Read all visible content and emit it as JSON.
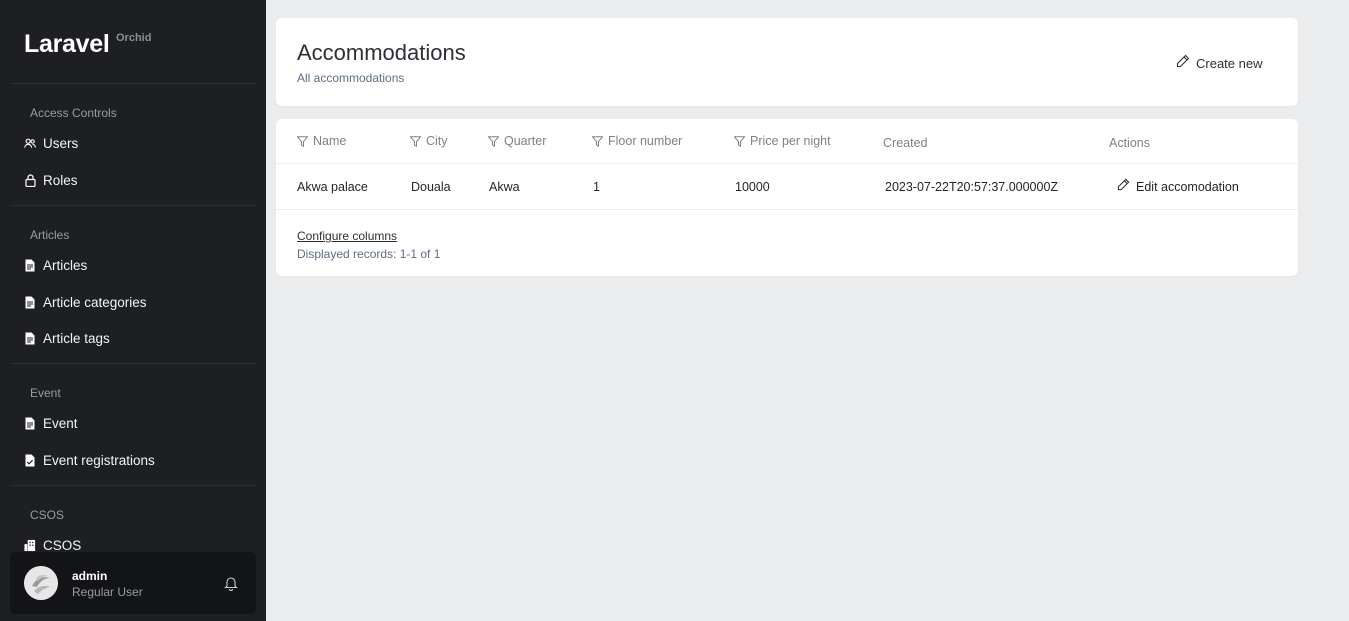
{
  "brand": {
    "name": "Laravel",
    "sub": "Orchid"
  },
  "sidebar": {
    "sections": [
      {
        "title": "Access Controls",
        "items": [
          {
            "label": "Users",
            "icon": "users-icon"
          },
          {
            "label": "Roles",
            "icon": "lock-icon"
          }
        ]
      },
      {
        "title": "Articles",
        "items": [
          {
            "label": "Articles",
            "icon": "file-icon"
          },
          {
            "label": "Article categories",
            "icon": "file-icon"
          },
          {
            "label": "Article tags",
            "icon": "file-icon"
          }
        ]
      },
      {
        "title": "Event",
        "items": [
          {
            "label": "Event",
            "icon": "file-icon"
          },
          {
            "label": "Event registrations",
            "icon": "file-check-icon"
          }
        ]
      },
      {
        "title": "CSOS",
        "items": [
          {
            "label": "CSOS",
            "icon": "building-icon"
          }
        ]
      }
    ]
  },
  "user": {
    "name": "admin",
    "role": "Regular User"
  },
  "page": {
    "title": "Accommodations",
    "subtitle": "All accommodations",
    "create_label": "Create new"
  },
  "table": {
    "columns": [
      "Name",
      "City",
      "Quarter",
      "Floor number",
      "Price per night",
      "Created",
      "Actions"
    ],
    "rows": [
      {
        "name": "Akwa palace",
        "city": "Douala",
        "quarter": "Akwa",
        "floor": "1",
        "price": "10000",
        "created": "2023-07-22T20:57:37.000000Z",
        "action": "Edit accomodation"
      }
    ],
    "configure_label": "Configure columns",
    "records_label": "Displayed records: 1-1 of 1"
  },
  "colors": {
    "sidebar_bg": "#1e1f23",
    "page_bg": "#ebecee",
    "panel_bg": "#ffffff"
  }
}
